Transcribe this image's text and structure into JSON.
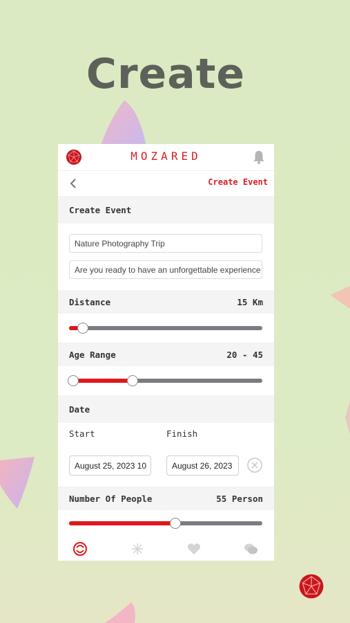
{
  "hero": {
    "title": "Create"
  },
  "app": {
    "brand": "MOZARED"
  },
  "nav": {
    "title": "Create Event"
  },
  "create_section": {
    "title": "Create Event"
  },
  "form": {
    "event_name": "Nature Photography Trip",
    "event_description": "Are you ready to have an unforgettable experience"
  },
  "distance": {
    "label": "Distance",
    "value": "15 Km",
    "fraction": 0.07
  },
  "age_range": {
    "label": "Age Range",
    "value": "20 - 45",
    "low": 20,
    "high": 45
  },
  "date": {
    "label": "Date",
    "start_label": "Start",
    "finish_label": "Finish",
    "start_value": "August 25, 2023 10",
    "finish_value": "August 26, 2023"
  },
  "people": {
    "label": "Number Of People",
    "value": "55 Person",
    "fraction": 0.55
  },
  "tabs": [
    "home-icon",
    "explore-icon",
    "heart-icon",
    "chat-icon"
  ],
  "colors": {
    "accent": "#d81f26",
    "background": "#dbeac2",
    "track": "#7b7b84"
  }
}
